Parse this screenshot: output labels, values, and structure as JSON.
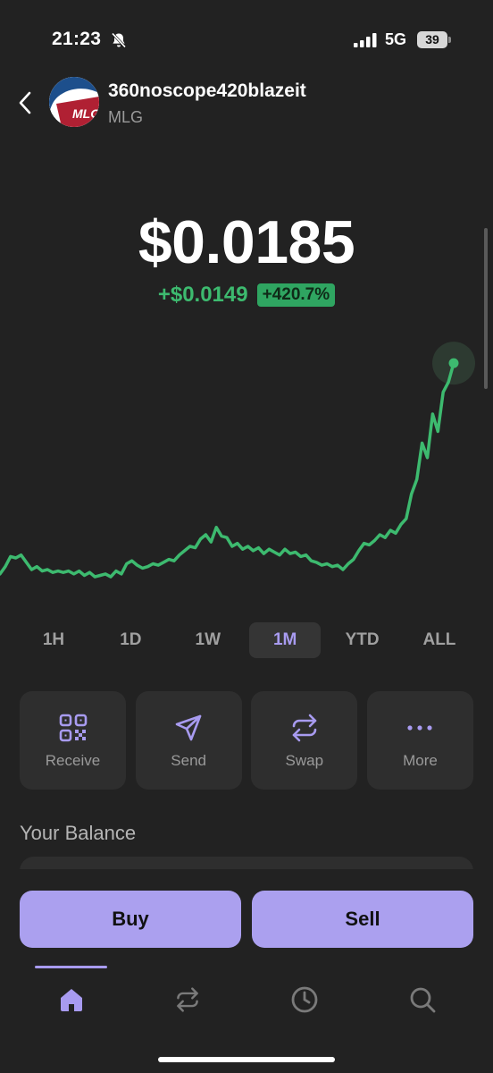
{
  "status_bar": {
    "time": "21:23",
    "network": "5G",
    "battery": "39",
    "icons": [
      "bell-slash-icon",
      "signal-icon",
      "battery-icon"
    ]
  },
  "header": {
    "back_icon": "chevron-left-icon",
    "token_name": "360noscope420blazeit",
    "token_symbol": "MLG",
    "avatar_text": "MLG"
  },
  "price": {
    "value": "$0.0185",
    "change_abs": "+$0.0149",
    "change_pct": "+420.7%"
  },
  "colors": {
    "accent": "#a89bf0",
    "positive": "#3dba6f",
    "background": "#222222",
    "card": "#2e2e2e",
    "button": "#aba0ef"
  },
  "chart_data": {
    "type": "line",
    "title": "",
    "xlabel": "",
    "ylabel": "",
    "range": "1M",
    "grid": false,
    "series": [
      {
        "values": [
          0.004,
          0.0045,
          0.0052,
          0.0051,
          0.0053,
          0.0048,
          0.0043,
          0.0045,
          0.0042,
          0.0043,
          0.0041,
          0.0042,
          0.0041,
          0.0042,
          0.004,
          0.0042,
          0.0039,
          0.0041,
          0.0038,
          0.0039,
          0.004,
          0.0038,
          0.0042,
          0.004,
          0.0047,
          0.0049,
          0.0046,
          0.0044,
          0.0045,
          0.0047,
          0.0046,
          0.0048,
          0.005,
          0.0049,
          0.0053,
          0.0056,
          0.0059,
          0.0058,
          0.0064,
          0.0067,
          0.0062,
          0.0072,
          0.0066,
          0.0065,
          0.0059,
          0.0061,
          0.0057,
          0.0059,
          0.0056,
          0.0058,
          0.0054,
          0.0057,
          0.0055,
          0.0053,
          0.0057,
          0.0054,
          0.0055,
          0.0052,
          0.0053,
          0.0049,
          0.0048,
          0.0046,
          0.0047,
          0.0045,
          0.0046,
          0.0043,
          0.0047,
          0.005,
          0.0056,
          0.0061,
          0.006,
          0.0063,
          0.0067,
          0.0065,
          0.007,
          0.0068,
          0.0074,
          0.0078,
          0.0095,
          0.0105,
          0.013,
          0.012,
          0.015,
          0.0138,
          0.0165,
          0.0172,
          0.0185
        ]
      }
    ]
  },
  "timeframes": {
    "items": [
      {
        "label": "1H"
      },
      {
        "label": "1D"
      },
      {
        "label": "1W"
      },
      {
        "label": "1M",
        "active": true
      },
      {
        "label": "YTD"
      },
      {
        "label": "ALL"
      }
    ]
  },
  "actions": {
    "items": [
      {
        "label": "Receive",
        "icon": "qr-code-icon"
      },
      {
        "label": "Send",
        "icon": "send-icon"
      },
      {
        "label": "Swap",
        "icon": "swap-icon"
      },
      {
        "label": "More",
        "icon": "more-icon"
      }
    ]
  },
  "balance": {
    "title": "Your Balance"
  },
  "trade": {
    "buy_label": "Buy",
    "sell_label": "Sell"
  },
  "nav": {
    "items": [
      {
        "icon": "home-icon",
        "active": true
      },
      {
        "icon": "swap-icon"
      },
      {
        "icon": "clock-icon"
      },
      {
        "icon": "search-icon"
      }
    ]
  }
}
